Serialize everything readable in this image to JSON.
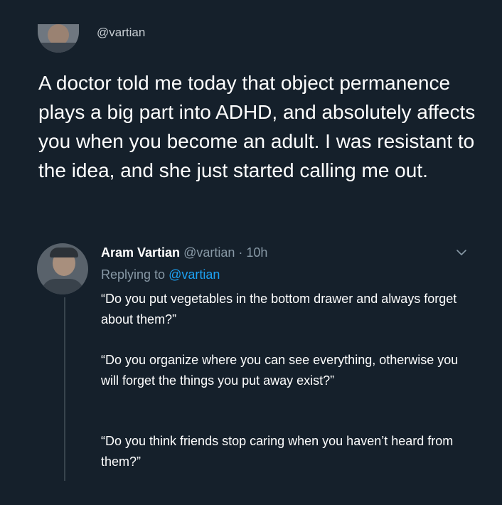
{
  "original_tweet": {
    "handle": "@vartian",
    "text": "A doctor told me today that object permanence plays a big part into ADHD, and absolutely affects you when you become an adult. I was resistant to the idea, and she just started calling me out."
  },
  "reply": {
    "display_name": "Aram Vartian",
    "meta": "@vartian · 10h",
    "replying_to_label": "Replying to ",
    "replying_to_handle": "@vartian",
    "paragraphs": [
      "“Do you put vegetables in the bottom drawer and always forget about them?”",
      "“Do you organize where you can see everything, otherwise you will forget the things you put away exist?”",
      "“Do you think friends stop caring when you haven’t heard from them?”"
    ]
  },
  "colors": {
    "background": "#15202b",
    "text": "#ffffff",
    "secondary_text": "#8899a6",
    "link": "#1da1f2",
    "thread_line": "#38444d"
  },
  "icons": {
    "more_menu": "chevron-down-icon"
  }
}
